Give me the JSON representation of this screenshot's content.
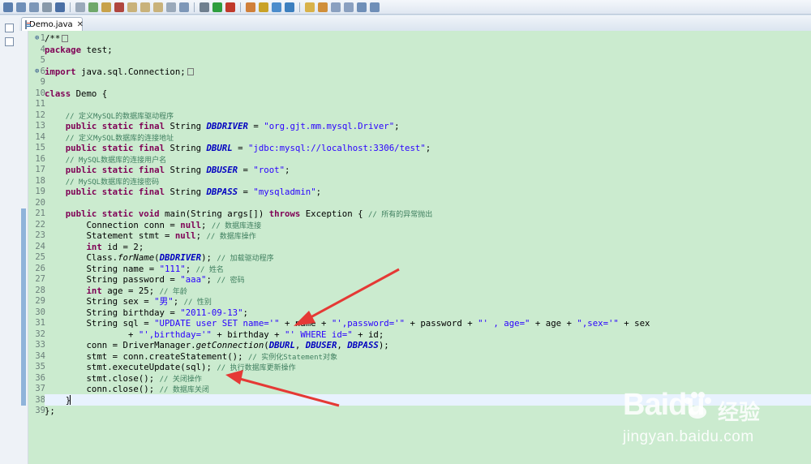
{
  "tab": {
    "file_name": "Demo.java",
    "close_glyph": "✕"
  },
  "toolbar_icons": [
    "new-icon",
    "save-icon",
    "save-all-icon",
    "print-icon",
    "select-icon",
    "debug-icon",
    "resume-icon",
    "suspend-icon",
    "terminate-icon",
    "step-into-icon",
    "step-over-icon",
    "step-return-icon",
    "drop-frame-icon",
    "use-step-filters-icon",
    "settings-icon",
    "run-icon",
    "run-external-icon",
    "new-class-icon",
    "new-package-icon",
    "search-icon",
    "open-type-icon",
    "highlight-icon",
    "pin-icon",
    "annotation-next-icon",
    "annotation-prev-icon",
    "back-icon",
    "forward-icon"
  ],
  "colors": {
    "editor_bg": "#cbebcf",
    "keyword": "#7f0055",
    "string": "#2a00ff",
    "field": "#0000c0",
    "comment": "#3f7f5f",
    "arrow": "#e53935",
    "current_line": "#e8f2fe"
  },
  "code": {
    "lines": [
      {
        "num": "1",
        "fold": "⊕",
        "segs": [
          [
            "/**",
            ""
          ]
        ]
      },
      {
        "num": "4",
        "segs": [
          [
            "package",
            "kw"
          ],
          [
            " test;",
            ""
          ]
        ]
      },
      {
        "num": "5",
        "segs": []
      },
      {
        "num": "6",
        "fold": "⊕",
        "segs": [
          [
            "import",
            "kw"
          ],
          [
            " java.sql.Connection;",
            ""
          ]
        ]
      },
      {
        "num": "9",
        "segs": []
      },
      {
        "num": "10",
        "segs": [
          [
            "class",
            "kw"
          ],
          [
            " Demo {",
            ""
          ]
        ]
      },
      {
        "num": "11",
        "segs": []
      },
      {
        "num": "12",
        "segs": [
          [
            "    ",
            ""
          ],
          [
            "// 定义MySQL的数据库驱动程序",
            "cm"
          ]
        ]
      },
      {
        "num": "13",
        "segs": [
          [
            "    ",
            ""
          ],
          [
            "public static final",
            "kw"
          ],
          [
            " String ",
            ""
          ],
          [
            "DBDRIVER",
            "fld"
          ],
          [
            " = ",
            ""
          ],
          [
            "\"org.gjt.mm.mysql.Driver\"",
            "st"
          ],
          [
            ";",
            ""
          ]
        ]
      },
      {
        "num": "14",
        "segs": [
          [
            "    ",
            ""
          ],
          [
            "// 定义MySQL数据库的连接地址",
            "cm"
          ]
        ]
      },
      {
        "num": "15",
        "segs": [
          [
            "    ",
            ""
          ],
          [
            "public static final",
            "kw"
          ],
          [
            " String ",
            ""
          ],
          [
            "DBURL",
            "fld"
          ],
          [
            " = ",
            ""
          ],
          [
            "\"jdbc:mysql://localhost:3306/test\"",
            "st"
          ],
          [
            ";",
            ""
          ]
        ]
      },
      {
        "num": "16",
        "segs": [
          [
            "    ",
            ""
          ],
          [
            "// MySQL数据库的连接用户名",
            "cm"
          ]
        ]
      },
      {
        "num": "17",
        "segs": [
          [
            "    ",
            ""
          ],
          [
            "public static final",
            "kw"
          ],
          [
            " String ",
            ""
          ],
          [
            "DBUSER",
            "fld"
          ],
          [
            " = ",
            ""
          ],
          [
            "\"root\"",
            "st"
          ],
          [
            ";",
            ""
          ]
        ]
      },
      {
        "num": "18",
        "segs": [
          [
            "    ",
            ""
          ],
          [
            "// MySQL数据库的连接密码",
            "cm"
          ]
        ]
      },
      {
        "num": "19",
        "segs": [
          [
            "    ",
            ""
          ],
          [
            "public static final",
            "kw"
          ],
          [
            " String ",
            ""
          ],
          [
            "DBPASS",
            "fld"
          ],
          [
            " = ",
            ""
          ],
          [
            "\"mysqladmin\"",
            "st"
          ],
          [
            ";",
            ""
          ]
        ]
      },
      {
        "num": "20",
        "segs": []
      },
      {
        "num": "21",
        "segs": [
          [
            "    ",
            ""
          ],
          [
            "public static void",
            "kw"
          ],
          [
            " main(String args[]) ",
            ""
          ],
          [
            "throws",
            "kw"
          ],
          [
            " Exception { ",
            ""
          ],
          [
            "// 所有的异常抛出",
            "cm"
          ]
        ]
      },
      {
        "num": "22",
        "segs": [
          [
            "        Connection conn = ",
            ""
          ],
          [
            "null",
            "kw"
          ],
          [
            "; ",
            ""
          ],
          [
            "// 数据库连接",
            "cm"
          ]
        ]
      },
      {
        "num": "23",
        "segs": [
          [
            "        Statement stmt = ",
            ""
          ],
          [
            "null",
            "kw"
          ],
          [
            "; ",
            ""
          ],
          [
            "// 数据库操作",
            "cm"
          ]
        ]
      },
      {
        "num": "24",
        "segs": [
          [
            "        ",
            ""
          ],
          [
            "int",
            "kw"
          ],
          [
            " id = 2;",
            ""
          ]
        ]
      },
      {
        "num": "25",
        "segs": [
          [
            "        Class.",
            ""
          ],
          [
            "forName",
            "it"
          ],
          [
            "(",
            ""
          ],
          [
            "DBDRIVER",
            "fld"
          ],
          [
            "); ",
            ""
          ],
          [
            "// 加载驱动程序",
            "cm"
          ]
        ]
      },
      {
        "num": "26",
        "segs": [
          [
            "        String name = ",
            ""
          ],
          [
            "\"111\"",
            "st"
          ],
          [
            "; ",
            ""
          ],
          [
            "// 姓名",
            "cm"
          ]
        ]
      },
      {
        "num": "27",
        "segs": [
          [
            "        String password = ",
            ""
          ],
          [
            "\"aaa\"",
            "st"
          ],
          [
            "; ",
            ""
          ],
          [
            "// 密码",
            "cm"
          ]
        ]
      },
      {
        "num": "28",
        "segs": [
          [
            "        ",
            ""
          ],
          [
            "int",
            "kw"
          ],
          [
            " age = 25; ",
            ""
          ],
          [
            "// 年龄",
            "cm"
          ]
        ]
      },
      {
        "num": "29",
        "segs": [
          [
            "        String sex = ",
            ""
          ],
          [
            "\"男\"",
            "st"
          ],
          [
            "; ",
            ""
          ],
          [
            "// 性别",
            "cm"
          ]
        ]
      },
      {
        "num": "30",
        "segs": [
          [
            "        String birthday = ",
            ""
          ],
          [
            "\"2011-09-13\"",
            "st"
          ],
          [
            ";",
            ""
          ]
        ]
      },
      {
        "num": "31",
        "segs": [
          [
            "        String sql = ",
            ""
          ],
          [
            "\"UPDATE user SET name='\"",
            "st"
          ],
          [
            " + name + ",
            ""
          ],
          [
            "\"',password='\"",
            "st"
          ],
          [
            " + password + ",
            ""
          ],
          [
            "\"' , age=\"",
            "st"
          ],
          [
            " + age + ",
            ""
          ],
          [
            "\",sex='\"",
            "st"
          ],
          [
            " + sex",
            ""
          ]
        ]
      },
      {
        "num": "32",
        "segs": [
          [
            "                + ",
            ""
          ],
          [
            "\"',birthday='\"",
            "st"
          ],
          [
            " + birthday + ",
            ""
          ],
          [
            "\"' WHERE id=\"",
            "st"
          ],
          [
            " + id;",
            ""
          ]
        ]
      },
      {
        "num": "33",
        "segs": [
          [
            "        conn = DriverManager.",
            ""
          ],
          [
            "getConnection",
            "it"
          ],
          [
            "(",
            ""
          ],
          [
            "DBURL",
            "fld"
          ],
          [
            ", ",
            ""
          ],
          [
            "DBUSER",
            "fld"
          ],
          [
            ", ",
            ""
          ],
          [
            "DBPASS",
            "fld"
          ],
          [
            ");",
            ""
          ]
        ]
      },
      {
        "num": "34",
        "segs": [
          [
            "        stmt = conn.createStatement(); ",
            ""
          ],
          [
            "// 实例化Statement对象",
            "cm"
          ]
        ]
      },
      {
        "num": "35",
        "segs": [
          [
            "        stmt.executeUpdate(sql); ",
            ""
          ],
          [
            "// 执行数据库更新操作",
            "cm"
          ]
        ]
      },
      {
        "num": "36",
        "segs": [
          [
            "        stmt.close(); ",
            ""
          ],
          [
            "// 关闭操作",
            "cm"
          ]
        ]
      },
      {
        "num": "37",
        "segs": [
          [
            "        conn.close(); ",
            ""
          ],
          [
            "// 数据库关闭",
            "cm"
          ]
        ]
      },
      {
        "num": "38",
        "segs": [
          [
            "    }",
            ""
          ]
        ]
      },
      {
        "num": "39",
        "segs": [
          [
            "};",
            ""
          ]
        ]
      }
    ]
  },
  "watermark": {
    "brand": "Baidu",
    "brand_cn": "经验",
    "url": "jingyan.baidu.com"
  }
}
